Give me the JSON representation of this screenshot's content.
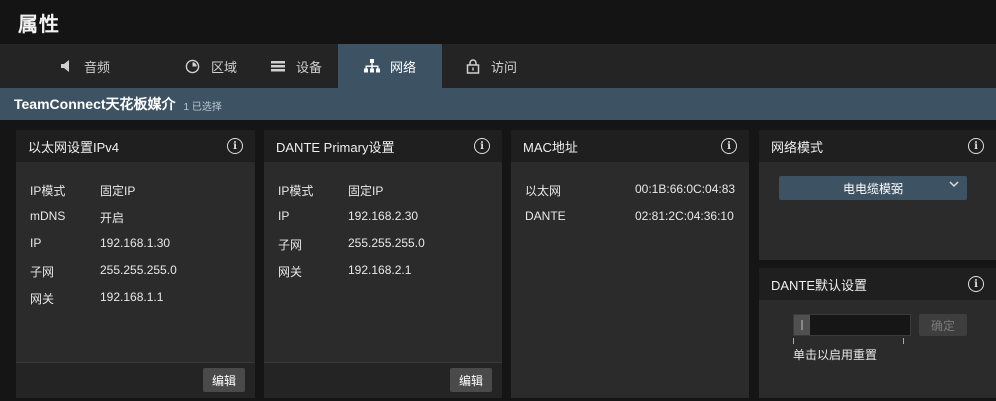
{
  "window": {
    "title": "属性"
  },
  "tabs": [
    {
      "label": "音频",
      "icon": "speaker-icon",
      "active": false
    },
    {
      "label": "区域",
      "icon": "zone-dial-icon",
      "active": false
    },
    {
      "label": "设备",
      "icon": "device-list-icon",
      "active": false
    },
    {
      "label": "网络",
      "icon": "network-icon",
      "active": true
    },
    {
      "label": "访问",
      "icon": "lock-icon",
      "active": false
    }
  ],
  "device": {
    "name": "TeamConnect天花板媒介",
    "selection": "1 已选择"
  },
  "ethernet": {
    "title": "以太网设置IPv4",
    "rows": [
      {
        "key": "IP模式",
        "value": "固定IP"
      },
      {
        "key": "mDNS",
        "value": "开启"
      },
      {
        "key": "IP",
        "value": "192.168.1.30"
      },
      {
        "key": "子网",
        "value": "255.255.255.0"
      },
      {
        "key": "网关",
        "value": "192.168.1.1"
      }
    ],
    "edit_label": "编辑"
  },
  "dante_primary": {
    "title": "DANTE Primary设置",
    "rows": [
      {
        "key": "IP模式",
        "value": "固定IP"
      },
      {
        "key": "IP",
        "value": "192.168.2.30"
      },
      {
        "key": "子网",
        "value": "255.255.255.0"
      },
      {
        "key": "网关",
        "value": "192.168.2.1"
      }
    ],
    "edit_label": "编辑"
  },
  "mac": {
    "title": "MAC地址",
    "rows": [
      {
        "key": "以太网",
        "value": "00:1B:66:0C:04:83"
      },
      {
        "key": "DANTE",
        "value": "02:81:2C:04:36:10"
      }
    ]
  },
  "network_mode": {
    "title": "网络模式",
    "selected": "电电缆模弼"
  },
  "dante_default": {
    "title": "DANTE默认设置",
    "confirm_label": "确定",
    "hint": "单击以启用重置"
  },
  "info_glyph": "i",
  "colors": {
    "accent": "#3d5262",
    "panel": "#2b2b2b",
    "header": "#1f1f1f",
    "background": "#151515"
  }
}
